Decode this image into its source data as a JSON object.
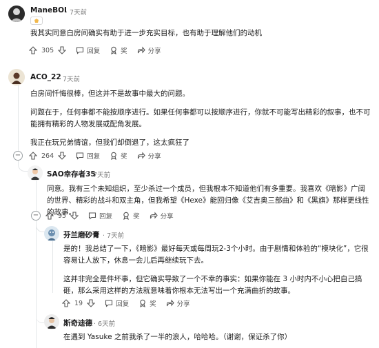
{
  "comments": [
    {
      "username": "ManeBOI",
      "time": "7天前",
      "body": [
        "我其实同意白房间确实有助于进一步充实目标，也有助于理解他们的动机"
      ],
      "votes": "305",
      "reply_label": "回复",
      "award_label": "奖",
      "share_label": "分享"
    },
    {
      "username": "ACO_22",
      "time": "7天前",
      "body": [
        "白房间忏悔很棒，但这并不是故事中最大的问题。",
        "问题在于，任何事都不能按顺序进行。如果任何事都可以按顺序进行，你就不可能写出精彩的叙事，也不可能拥有精彩的人物发展或配角发展。",
        "我正在玩兄弟情谊，但我们却倒退了，这太疯狂了"
      ],
      "votes": "264",
      "reply_label": "回复",
      "award_label": "奖",
      "share_label": "分享"
    },
    {
      "username": "SAO幸存者35",
      "time": "7天前",
      "body": [
        "同意。我有三个未知组织，至少杀过一个成员，但我根本不知道他们有多重要。我喜欢《暗影》广阔的世界、精彩的战斗和双主角，但我希望《Hexe》能回归像《艾吉奥三部曲》和《黑旗》那样更线性的故事。"
      ],
      "votes": "95",
      "reply_label": "回复",
      "award_label": "奖",
      "share_label": "分享"
    },
    {
      "username": "芬兰磨砂膏",
      "time": "7天前",
      "body": [
        "是的！我总结了一下，《暗影》最好每天或每周玩2-3个小时。由于剧情和体验的“模块化”，它很容易让人放下，休息一会儿后再继续玩下去。",
        "这并非完全是件坏事，但它确实导致了一个不幸的事实：如果你能在 3 小时内不小心把自己搞砸，那么采用这样的方法就意味着你根本无法写出一个充满曲折的故事。"
      ],
      "votes": "19",
      "reply_label": "回复",
      "award_label": "奖",
      "share_label": "分享"
    },
    {
      "username": "斯奇迪德",
      "time": "6天前",
      "body": [
        "在遇到 Yasuke 之前我杀了一半的浪人，哈哈哈。（谢谢，保证杀了你）"
      ]
    }
  ],
  "icons": {
    "upvote": "upvote-arrow-icon",
    "downvote": "downvote-arrow-icon",
    "reply": "reply-bubble-icon",
    "award": "award-ribbon-icon",
    "share": "share-arrow-icon",
    "collapse": "collapse-minus-icon"
  },
  "colors": {
    "meta": "#7c7c7c",
    "thread": "#e3e6e8",
    "text": "#1c1c1c"
  }
}
